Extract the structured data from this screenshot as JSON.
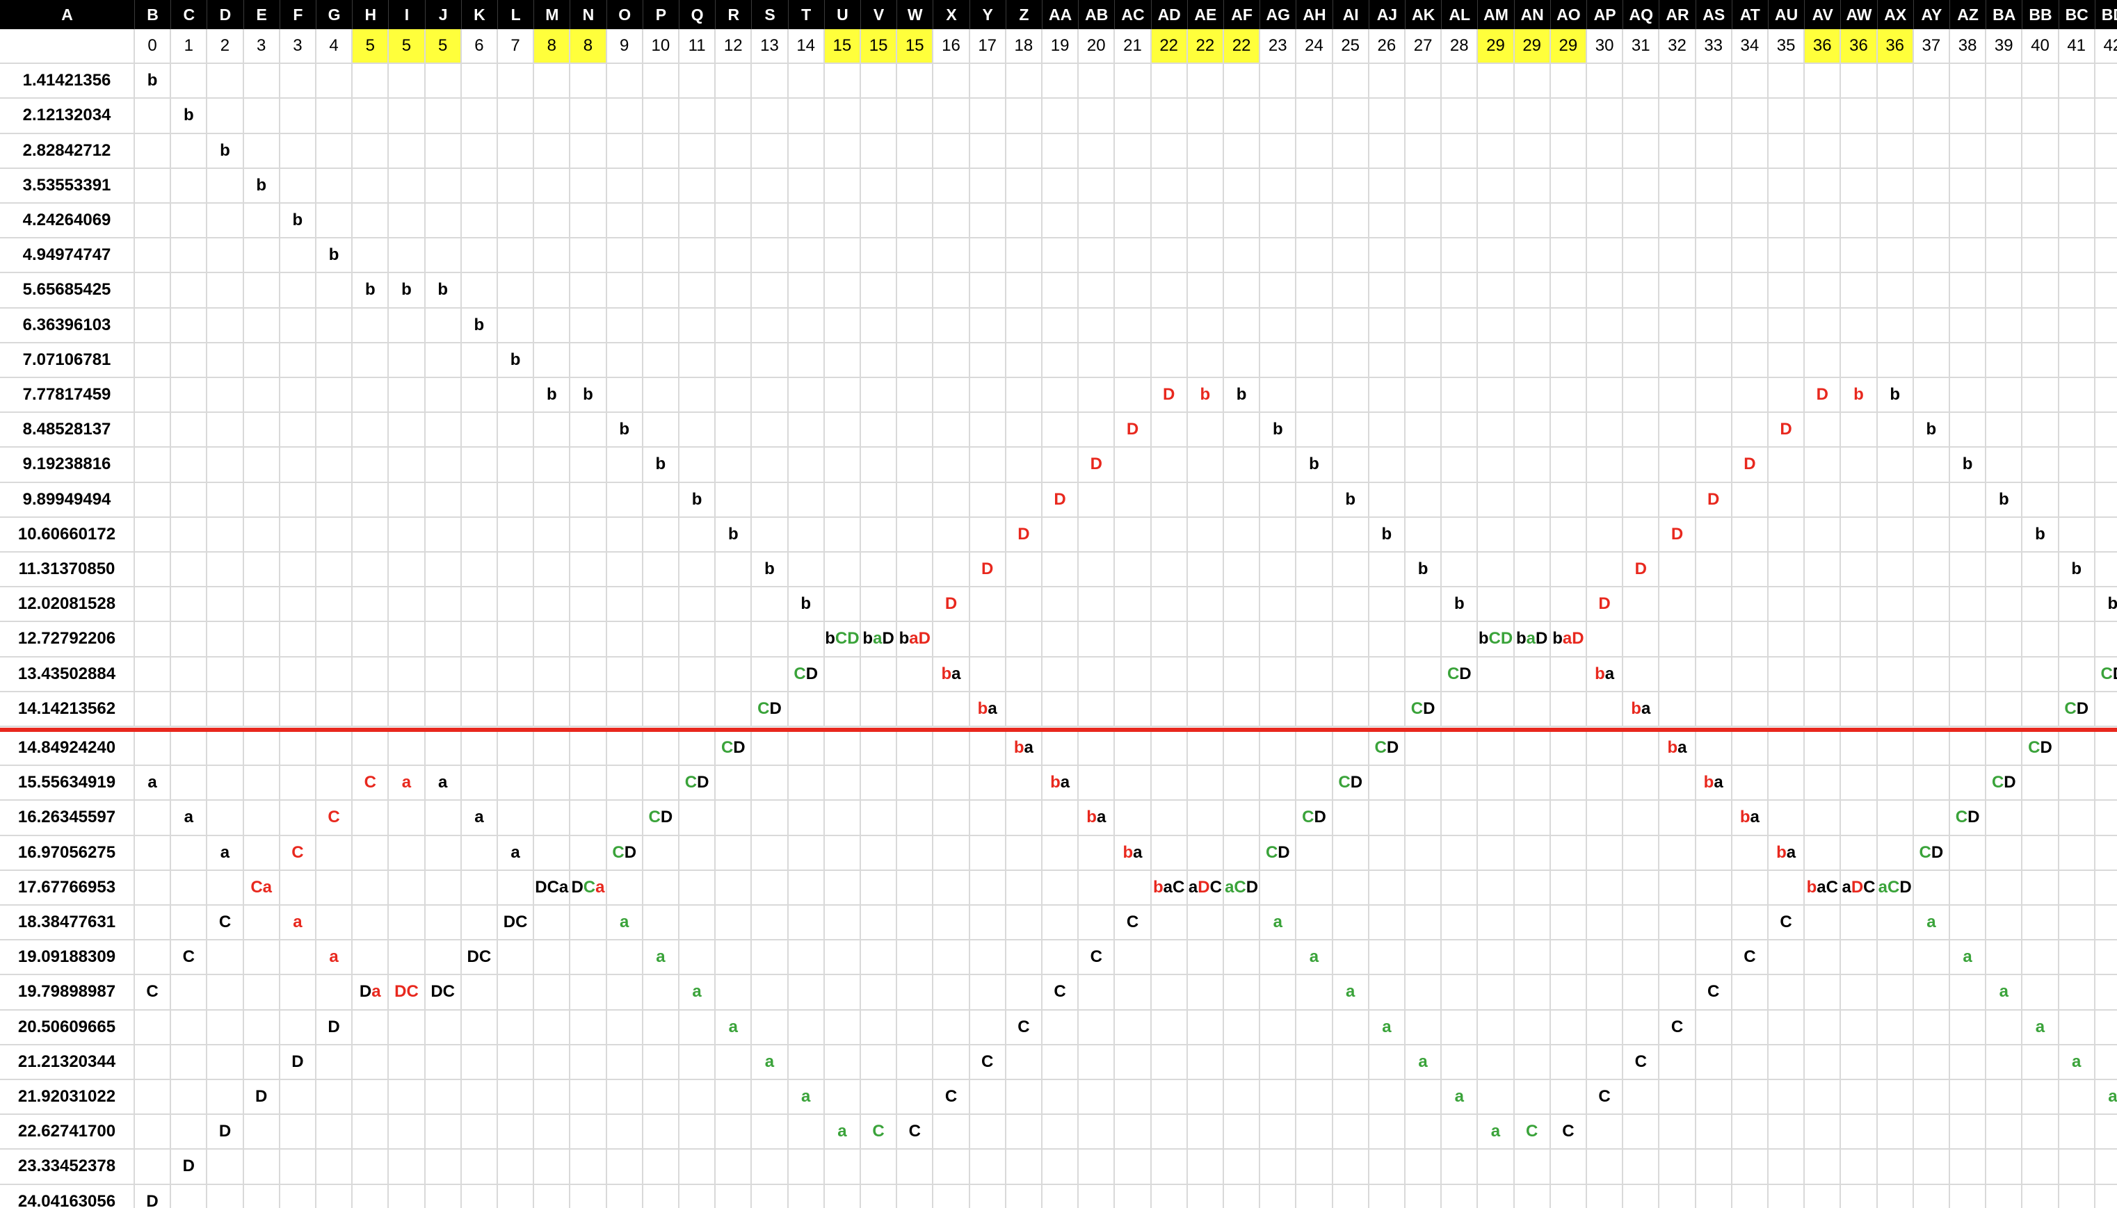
{
  "colors": {
    "black": "#000000",
    "red": "#e8281e",
    "green": "#3aa33a",
    "highlight": "#ffff3b",
    "grid": "#d9d9d9"
  },
  "columns": [
    "A",
    "B",
    "C",
    "D",
    "E",
    "F",
    "G",
    "H",
    "I",
    "J",
    "K",
    "L",
    "M",
    "N",
    "O",
    "P",
    "Q",
    "R",
    "S",
    "T",
    "U",
    "V",
    "W",
    "X",
    "Y",
    "Z",
    "AA",
    "AB",
    "AC",
    "AD",
    "AE",
    "AF",
    "AG",
    "AH",
    "AI",
    "AJ",
    "AK",
    "AL",
    "AM",
    "AN",
    "AO",
    "AP",
    "AQ",
    "AR",
    "AS",
    "AT",
    "AU",
    "AV",
    "AW",
    "AX",
    "AY",
    "AZ",
    "BA",
    "BB",
    "BC",
    "BD"
  ],
  "index_row": [
    "0",
    "1",
    "2",
    "3",
    "3",
    "4",
    "5",
    "5",
    "5",
    "6",
    "7",
    "8",
    "8",
    "9",
    "10",
    "11",
    "12",
    "13",
    "14",
    "15",
    "15",
    "15",
    "16",
    "17",
    "18",
    "19",
    "20",
    "21",
    "22",
    "22",
    "22",
    "23",
    "24",
    "25",
    "26",
    "27",
    "28",
    "29",
    "29",
    "29",
    "30",
    "31",
    "32",
    "33",
    "34",
    "35",
    "36",
    "36",
    "36",
    "37",
    "38",
    "39",
    "40",
    "41",
    "42"
  ],
  "index_highlight": [
    "H",
    "I",
    "J",
    "M",
    "N",
    "U",
    "V",
    "W",
    "AD",
    "AE",
    "AF",
    "AM",
    "AN",
    "AO",
    "AV",
    "AW",
    "AX"
  ],
  "rows": [
    {
      "label": "1.41421356",
      "cells": {
        "B": "b"
      }
    },
    {
      "label": "2.12132034",
      "cells": {
        "C": "b"
      }
    },
    {
      "label": "2.82842712",
      "cells": {
        "D": "b"
      }
    },
    {
      "label": "3.53553391",
      "cells": {
        "E": "b"
      }
    },
    {
      "label": "4.24264069",
      "cells": {
        "F": "b"
      }
    },
    {
      "label": "4.94974747",
      "cells": {
        "G": "b"
      }
    },
    {
      "label": "5.65685425",
      "cells": {
        "H": "b",
        "I": "b",
        "J": "b"
      }
    },
    {
      "label": "6.36396103",
      "cells": {
        "K": "b"
      }
    },
    {
      "label": "7.07106781",
      "cells": {
        "L": "b"
      }
    },
    {
      "label": "7.77817459",
      "cells": {
        "M": "b",
        "N": "b",
        "AD": "D|r",
        "AE": "b|r",
        "AF": "b",
        "AV": "D|r",
        "AW": "b|r",
        "AX": "b"
      }
    },
    {
      "label": "8.48528137",
      "cells": {
        "O": "b",
        "AC": "D|r",
        "AG": "b",
        "AU": "D|r",
        "AY": "b"
      }
    },
    {
      "label": "9.19238816",
      "cells": {
        "P": "b",
        "AB": "D|r",
        "AH": "b",
        "AT": "D|r",
        "AZ": "b"
      }
    },
    {
      "label": "9.89949494",
      "cells": {
        "Q": "b",
        "AA": "D|r",
        "AI": "b",
        "AS": "D|r",
        "BA": "b"
      }
    },
    {
      "label": "10.60660172",
      "cells": {
        "R": "b",
        "Z": "D|r",
        "AJ": "b",
        "AR": "D|r",
        "BB": "b"
      }
    },
    {
      "label": "11.31370850",
      "cells": {
        "S": "b",
        "Y": "D|r",
        "AK": "b",
        "AQ": "D|r",
        "BC": "b"
      }
    },
    {
      "label": "12.02081528",
      "cells": {
        "T": "b",
        "X": "D|r",
        "AL": "b",
        "AP": "D|r",
        "BD": "b"
      }
    },
    {
      "label": "12.72792206",
      "cells": {
        "U": "b|k,CD|g",
        "V": "b|k,a|g,D|k",
        "W": "b|k,a|r,D|r",
        "AM": "b|k,CD|g",
        "AN": "b|k,a|g,D|k",
        "AO": "b|k,a|r,D|r"
      }
    },
    {
      "label": "13.43502884",
      "cells": {
        "T": "C|g,D|k",
        "X": "b|r,a|k",
        "AL": "C|g,D|k",
        "AP": "b|r,a|k",
        "BD": "C|g,D|k"
      }
    },
    {
      "label": "14.14213562",
      "cells": {
        "S": "C|g,D|k",
        "Y": "b|r,a|k",
        "AK": "C|g,D|k",
        "AQ": "b|r,a|k",
        "BC": "C|g,D|k"
      }
    },
    {
      "label": "14.84924240",
      "cells": {
        "R": "C|g,D|k",
        "Z": "b|r,a|k",
        "AJ": "C|g,D|k",
        "AR": "b|r,a|k",
        "BB": "C|g,D|k"
      }
    },
    {
      "label": "15.55634919",
      "cells": {
        "B": "a",
        "H": "C|r",
        "I": "a|r",
        "J": "a",
        "Q": "C|g,D|k",
        "AA": "b|r,a|k",
        "AI": "C|g,D|k",
        "AS": "b|r,a|k",
        "BA": "C|g,D|k"
      }
    },
    {
      "label": "16.26345597",
      "cells": {
        "C": "a",
        "G": "C|r",
        "K": "a",
        "P": "C|g,D|k",
        "AB": "b|r,a|k",
        "AH": "C|g,D|k",
        "AT": "b|r,a|k",
        "AZ": "C|g,D|k"
      }
    },
    {
      "label": "16.97056275",
      "cells": {
        "D": "a",
        "F": "C|r",
        "L": "a",
        "O": "C|g,D|k",
        "AC": "b|r,a|k",
        "AG": "C|g,D|k",
        "AU": "b|r,a|k",
        "AY": "C|g,D|k"
      }
    },
    {
      "label": "17.67766953",
      "cells": {
        "E": "Ca|r",
        "M": "DCa",
        "N": "D|k,C|g,a|r",
        "AD": "b|r,a|k,C|k",
        "AE": "a|k,D|r,C|k",
        "AF": "a|g,C|g,D|k",
        "AV": "b|r,a|k,C|k",
        "AW": "a|k,D|r,C|k",
        "AX": "a|g,C|g,D|k"
      }
    },
    {
      "label": "18.38477631",
      "cells": {
        "D": "C",
        "F": "a|r",
        "L": "DC",
        "O": "a|g",
        "AC": "C",
        "AG": "a|g",
        "AU": "C",
        "AY": "a|g"
      }
    },
    {
      "label": "19.09188309",
      "cells": {
        "C": "C",
        "G": "a|r",
        "K": "DC",
        "P": "a|g",
        "AB": "C",
        "AH": "a|g",
        "AT": "C",
        "AZ": "a|g"
      }
    },
    {
      "label": "19.79898987",
      "cells": {
        "B": "C",
        "H": "D|k,a|r",
        "I": "D|r,C|r",
        "J": "DC",
        "Q": "a|g",
        "AA": "C",
        "AI": "a|g",
        "AS": "C",
        "BA": "a|g"
      }
    },
    {
      "label": "20.50609665",
      "cells": {
        "G": "D",
        "R": "a|g",
        "Z": "C",
        "AJ": "a|g",
        "AR": "C",
        "BB": "a|g"
      }
    },
    {
      "label": "21.21320344",
      "cells": {
        "F": "D",
        "S": "a|g",
        "Y": "C",
        "AK": "a|g",
        "AQ": "C",
        "BC": "a|g"
      }
    },
    {
      "label": "21.92031022",
      "cells": {
        "E": "D",
        "T": "a|g",
        "X": "C",
        "AL": "a|g",
        "AP": "C",
        "BD": "a|g"
      }
    },
    {
      "label": "22.62741700",
      "cells": {
        "D": "D",
        "U": "a|g",
        "V": "C|g",
        "W": "C",
        "AM": "a|g",
        "AN": "C|g",
        "AO": "C"
      }
    },
    {
      "label": "23.33452378",
      "cells": {
        "C": "D"
      }
    },
    {
      "label": "24.04163056",
      "cells": {
        "B": "D"
      }
    }
  ]
}
